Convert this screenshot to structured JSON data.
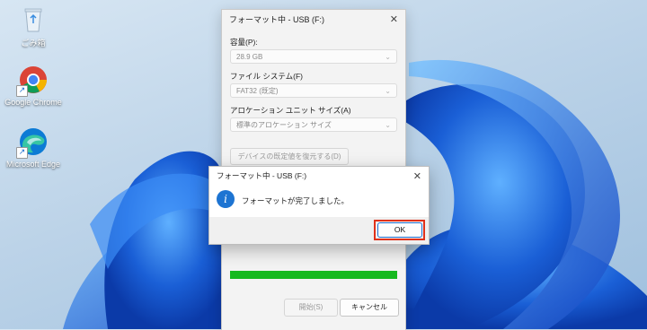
{
  "desktop": {
    "icons": [
      {
        "label": "ごみ箱",
        "icon": "recycle-bin-icon"
      },
      {
        "label": "Google Chrome",
        "icon": "chrome-icon"
      },
      {
        "label": "Microsoft Edge",
        "icon": "edge-icon"
      }
    ],
    "wallpaper_color": "#1a5fd6"
  },
  "format_window": {
    "title": "フォーマット中 - USB (F:)",
    "capacity_label": "容量(P):",
    "capacity_value": "28.9 GB",
    "filesystem_label": "ファイル システム(F)",
    "filesystem_value": "FAT32 (既定)",
    "allocation_label": "アロケーション ユニット サイズ(A)",
    "allocation_value": "標準のアロケーション サイズ",
    "restore_defaults_label": "デバイスの既定値を復元する(D)",
    "progress": 1.0,
    "start_label": "開始(S)",
    "cancel_label": "キャンセル",
    "progress_color": "#16b91f"
  },
  "message_box": {
    "title": "フォーマット中 - USB (F:)",
    "message": "フォーマットが完了しました。",
    "ok_label": "OK",
    "icon": "info-icon",
    "highlight_color": "#e0311b"
  }
}
